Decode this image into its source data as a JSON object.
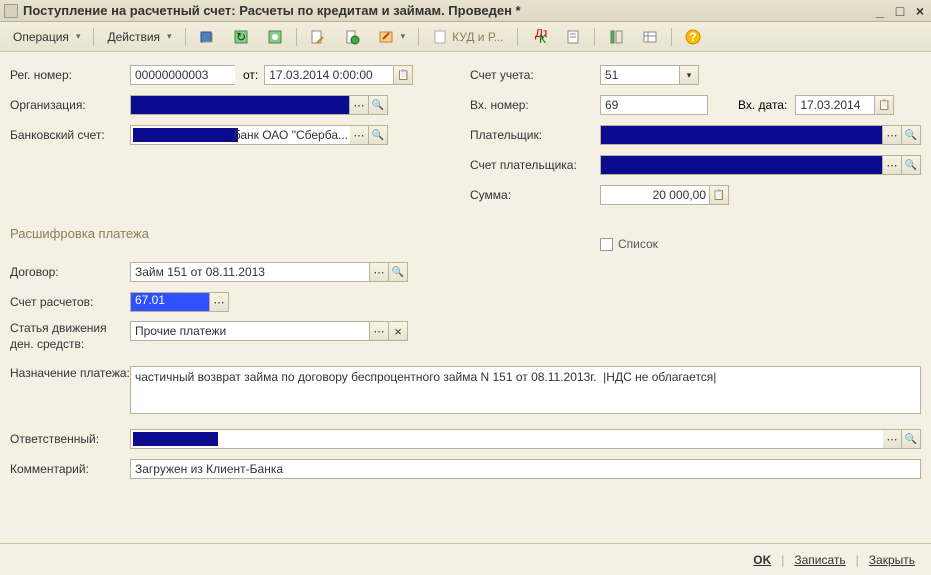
{
  "window": {
    "title": "Поступление на расчетный счет: Расчеты по кредитам и займам. Проведен *"
  },
  "toolbar": {
    "operation": "Операция",
    "actions": "Действия",
    "kudir": "КУД и Р..."
  },
  "left": {
    "reg_label": "Рег. номер:",
    "reg_value": "00000000003",
    "from_label": "от:",
    "from_value": "17.03.2014 0:00:00",
    "org_label": "Организация:",
    "org_value": " ",
    "bank_label": "Банковский счет:",
    "bank_value": "банк ОАО \"Сберба..."
  },
  "right": {
    "account_label": "Счет учета:",
    "account_value": "51",
    "in_no_label": "Вх. номер:",
    "in_no_value": "69",
    "in_date_label": "Вх. дата:",
    "in_date_value": "17.03.2014",
    "payer_label": "Плательщик:",
    "payer_value": " ",
    "payer_acc_label": "Счет плательщика:",
    "payer_acc_value": " ",
    "sum_label": "Сумма:",
    "sum_value": "20 000,00",
    "list_label": "Список"
  },
  "section": {
    "title": "Расшифровка платежа",
    "contract_label": "Договор:",
    "contract_value": "Займ 151 от 08.11.2013",
    "settle_label": "Счет расчетов:",
    "settle_value": "67.01",
    "cashflow_label": "Статья движения ден. средств:",
    "cashflow_value": "Прочие платежи",
    "purpose_label": "Назначение платежа:",
    "purpose_value": "частичный возврат займа по договору беспроцентного займа N 151 от 08.11.2013г.  |НДС не облагается|",
    "responsible_label": "Ответственный:",
    "responsible_value": " ",
    "comment_label": "Комментарий:",
    "comment_value": "Загружен из Клиент-Банка"
  },
  "footer": {
    "ok": "OK",
    "write": "Записать",
    "close": "Закрыть"
  }
}
